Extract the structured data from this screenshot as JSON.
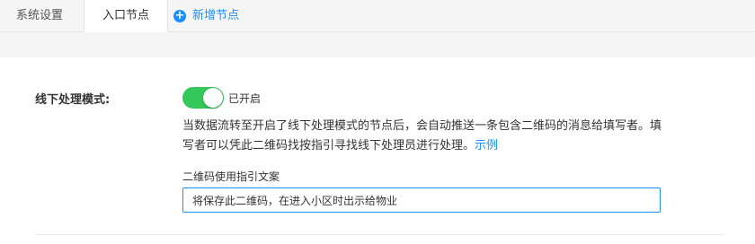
{
  "tabs": {
    "system_settings": "系统设置",
    "entry_node": "入口节点",
    "add_node": "新增节点"
  },
  "form": {
    "offline_mode_label": "线下处理模式:",
    "switch_on": true,
    "switch_status": "已开启",
    "description": "当数据流转至开启了线下处理模式的节点后，会自动推送一条包含二维码的消息给填写者。填写者可以凭此二维码找按指引寻找线下处理员进行处理。",
    "example_link": "示例",
    "guide_label": "二维码使用指引文案",
    "guide_value": "将保存此二维码，在进入小区时出示给物业"
  },
  "colors": {
    "accent": "#1890ff",
    "switch_on": "#34c759"
  },
  "icons": {
    "add": "plus-circle-icon"
  }
}
